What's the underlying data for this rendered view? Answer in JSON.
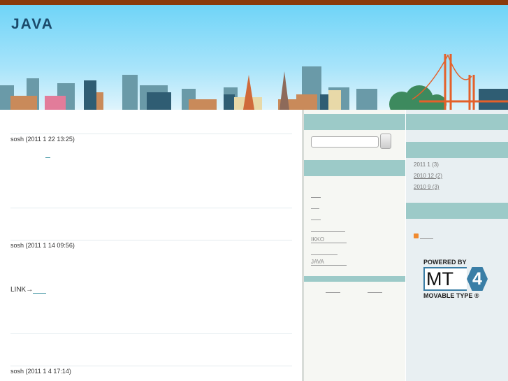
{
  "header": {
    "title": "JAVA"
  },
  "posts": [
    {
      "meta": "sosh (2011 1 22  13:25)"
    },
    {
      "meta": "sosh (2011 1 14  09:56)",
      "link_prefix": "LINK→"
    },
    {
      "meta": "sosh (2011 1  4  17:14)"
    }
  ],
  "sidebar_left": {
    "categories": [
      "",
      "",
      "",
      "",
      "IKKO",
      "",
      "JAVA"
    ]
  },
  "sidebar_right": {
    "archives": [
      {
        "label": "2011 1  (3)"
      },
      {
        "label": "2010 12  (2)"
      },
      {
        "label": "2010 9  (3)"
      }
    ],
    "powered_by": {
      "top": "POWERED BY",
      "mark": "MT",
      "version": "4",
      "bottom": "MOVABLE TYPE ®"
    }
  },
  "colors": {
    "top_bar": "#8a3a0c",
    "title": "#1b4a6b",
    "widget_bar": "#9ccac8",
    "mt_blue": "#3a7ea6"
  }
}
